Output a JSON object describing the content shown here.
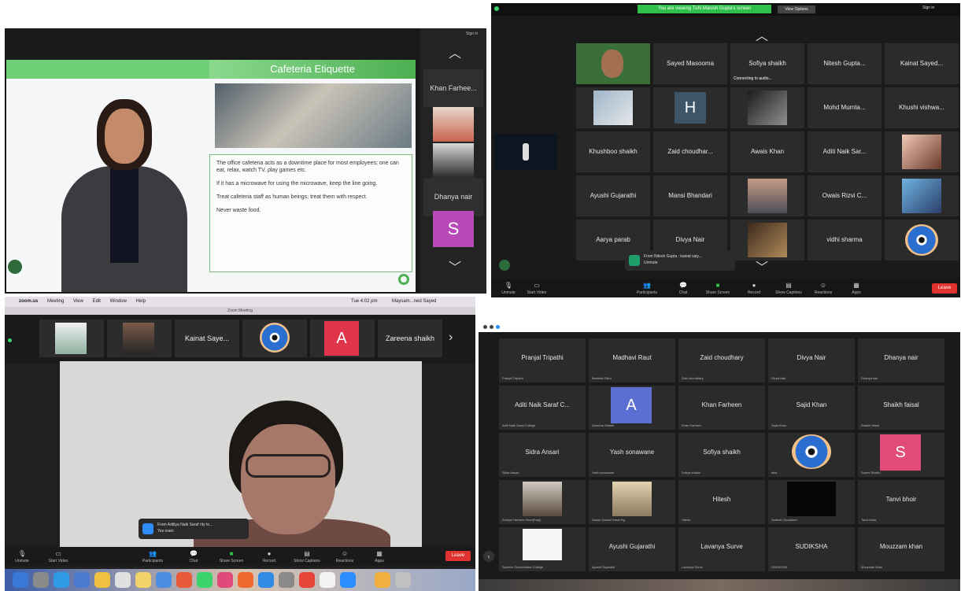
{
  "panel1": {
    "slide_title": "Cafeteria Etiquette",
    "bullets": [
      "The office cafeteria acts as a downtime place for most employees; one can eat, relax, watch TV, play games etc.",
      "If it has a microwave for using the microwave, keep the line going.",
      "Treat cafeteria staff as human beings; treat them with respect.",
      "Never waste food."
    ],
    "side_tiles": {
      "top": "Khan Farhee...",
      "mid": "Dhanya nair",
      "avatar_letter": "S"
    }
  },
  "panel2": {
    "banner": "You are viewing Tuhi Manish Gupta's screen",
    "view_options": "View Options",
    "sign_in": "Sign in",
    "grid": [
      [
        "",
        "Sayed Masooma",
        "Sofiya shaikh",
        "Nitesh Gupta...",
        "Kainat Sayed..."
      ],
      [
        "",
        "H",
        "",
        "Mohd Mumta...",
        "Khushi vishwa..."
      ],
      [
        "Khushboo shaikh",
        "Zaid choudhar...",
        "Awais Khan",
        "Aditi Naik Sar...",
        ""
      ],
      [
        "Ayushi Gujarathi",
        "Mansi Bhandari",
        "",
        "Owais Rizvi C...",
        ""
      ],
      [
        "Aarya parab",
        "Divya Nair",
        "",
        "vidhi sharma",
        ""
      ]
    ],
    "connecting": "Connecting to audio...",
    "toast": {
      "title": "From Nitesh Gupta : kainat saiy...",
      "body": "Unmute"
    },
    "toolbar": [
      "Unmute",
      "Start Video",
      "Participants",
      "Chat",
      "Share Screen",
      "Record",
      "Show Captions",
      "Reactions",
      "Apps"
    ],
    "leave": "Leave"
  },
  "panel3": {
    "menubar": [
      "zoom.us",
      "Meeting",
      "View",
      "Edit",
      "Window",
      "Help"
    ],
    "menubar_right": [
      "Tue 4:02 pm",
      "Maysam...ned Sayed"
    ],
    "window_title": "Zoom Meeting",
    "strip": {
      "name1": "Kainat Saye...",
      "letter": "A",
      "name2": "Zareena shaikh"
    },
    "toast": {
      "title": "From Aditiya Naik Saraf rity to...",
      "body": "Yes mam"
    },
    "toolbar": [
      "Unmute",
      "Start Video",
      "Participants",
      "Chat",
      "Share Screen",
      "Record",
      "Show Captions",
      "Reactions",
      "Apps"
    ],
    "leave": "Leave"
  },
  "panel4": {
    "grid": [
      [
        "Pranjal Tripathi",
        "Madhavi Raut",
        "Zaid choudhary",
        "Divya Nair",
        "Dhanya nair"
      ],
      [
        "Aditi Naik Saraf C...",
        "A",
        "Khan Farheen",
        "Sajid Khan",
        "Shaikh faisal"
      ],
      [
        "Sidra Ansari",
        "Yash sonawane",
        "Sofiya shaikh",
        "",
        "S"
      ],
      [
        "",
        "",
        "Hitesh",
        "",
        "Tanvi bhoir"
      ],
      [
        "",
        "Ayushi Gujarathi",
        "Lavanya Surve",
        "SUDIKSHA",
        "Mouzzam khan"
      ]
    ],
    "subs": [
      [
        "Pranjal Tripathi",
        "Madhavi Raut",
        "Zaid choudhary",
        "Divya Nair",
        "Dhanya nair"
      ],
      [
        "Aditi Naik Saraf College",
        "Zareena Shaikh",
        "Khan Farheen",
        "Sajid Khan",
        "Shaikh faisal"
      ],
      [
        "Sidra Ansari",
        "Yash sonawane",
        "Sofiya shaikh",
        "attiz",
        "Soomi Shaikh"
      ],
      [
        "Soniya Farheen Khan(Faqi)",
        "Saloni Gowari Saraf Rg",
        "Hitesh",
        "Sailesh Choudhari",
        "Tanvi bhoir"
      ],
      [
        "Sameer Oberoi/Asha College",
        "Ayushi Gujarathi",
        "Lavanya Surve",
        "SUDIKSHA",
        "Mouzzam khan"
      ]
    ]
  },
  "colors": {
    "zoom_dark": "#1a1a1a",
    "tile": "#2b2b2b",
    "leave_red": "#e0332f",
    "banner_green": "#2fbf4a",
    "slide_green": "#4caf50",
    "avatar_purple": "#b84ab8",
    "avatar_blue": "#5a6fd1",
    "avatar_red": "#e0344a",
    "avatar_pink": "#e24a7a"
  }
}
